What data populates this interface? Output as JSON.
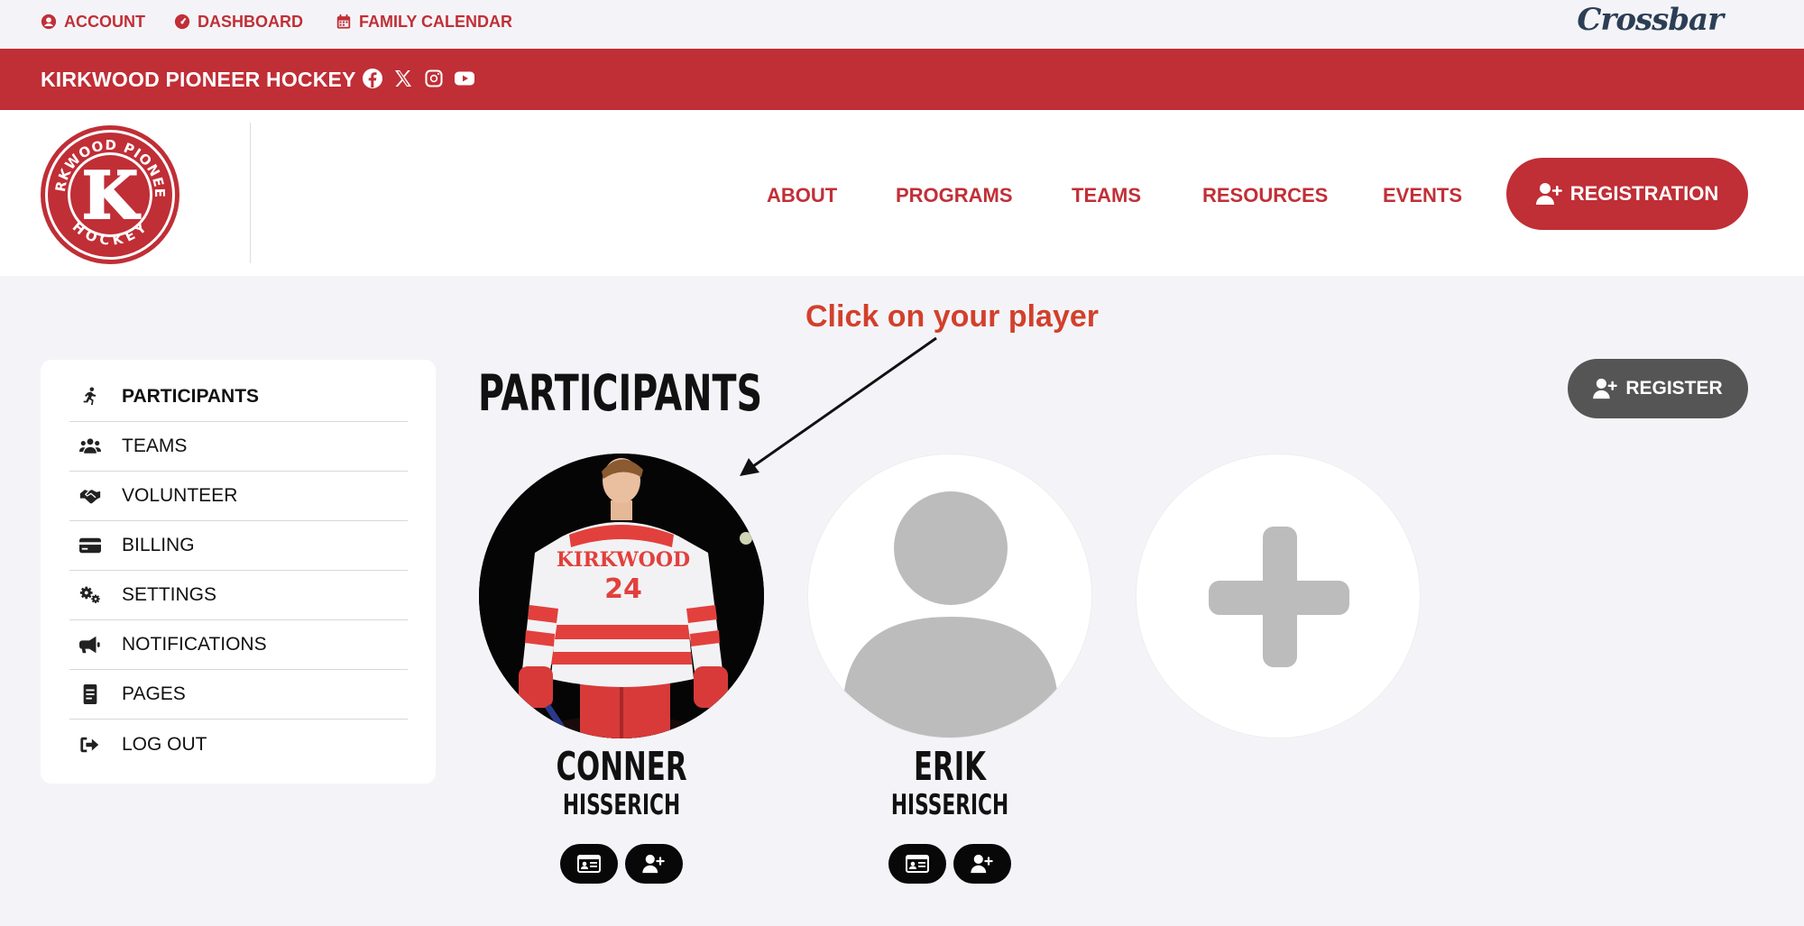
{
  "topbar": {
    "account": "ACCOUNT",
    "dashboard": "DASHBOARD",
    "family_calendar": "FAMILY CALENDAR",
    "brand": "Crossbar"
  },
  "org": {
    "name": "KIRKWOOD PIONEER HOCKEY",
    "socials": [
      "facebook-icon",
      "x-icon",
      "instagram-icon",
      "youtube-icon"
    ]
  },
  "logo": {
    "ring_text_top": "KIRKWOOD PIONEER",
    "ring_text_bottom": "HOCKEY",
    "letter": "K"
  },
  "nav": {
    "items": [
      "ABOUT",
      "PROGRAMS",
      "TEAMS",
      "RESOURCES",
      "EVENTS"
    ],
    "registration": "REGISTRATION"
  },
  "annotation": {
    "text": "Click on your player"
  },
  "sidebar": {
    "items": [
      {
        "label": "PARTICIPANTS",
        "icon": "running-icon",
        "active": true
      },
      {
        "label": "TEAMS",
        "icon": "users-icon",
        "active": false
      },
      {
        "label": "VOLUNTEER",
        "icon": "handshake-icon",
        "active": false
      },
      {
        "label": "BILLING",
        "icon": "credit-card-icon",
        "active": false
      },
      {
        "label": "SETTINGS",
        "icon": "gears-icon",
        "active": false
      },
      {
        "label": "NOTIFICATIONS",
        "icon": "megaphone-icon",
        "active": false
      },
      {
        "label": "PAGES",
        "icon": "document-icon",
        "active": false
      },
      {
        "label": "LOG OUT",
        "icon": "logout-icon",
        "active": false
      }
    ]
  },
  "main": {
    "title": "PARTICIPANTS",
    "register": "REGISTER",
    "participants": [
      {
        "first": "CONNER",
        "last": "HISSERICH",
        "jersey_text": "KIRKWOOD",
        "jersey_number": "24",
        "avatar": "player-photo"
      },
      {
        "first": "ERIK",
        "last": "HISSERICH",
        "avatar": "default-avatar"
      }
    ],
    "add_participant_icon": "plus-icon"
  },
  "colors": {
    "brand_red": "#c02e36",
    "link_red": "#c12f37",
    "annotation_red": "#d2402c",
    "dark_button": "#555555",
    "page_bg": "#f4f4f8"
  }
}
